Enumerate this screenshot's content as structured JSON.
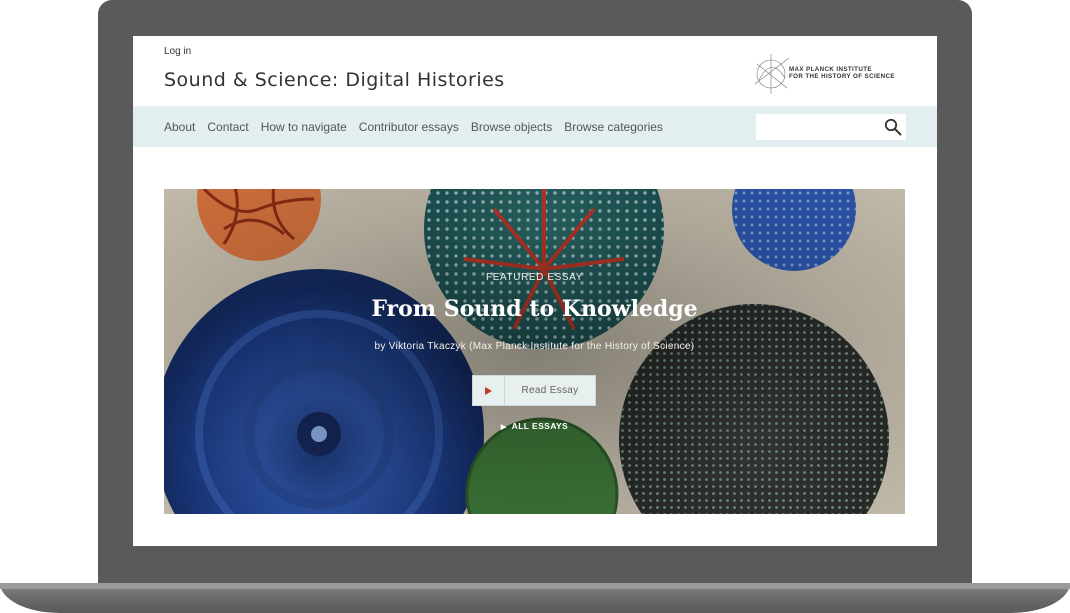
{
  "header": {
    "login": "Log in",
    "site_title": "Sound & Science: Digital Histories",
    "logo_line1": "MAX PLANCK INSTITUTE",
    "logo_line2": "FOR THE HISTORY OF SCIENCE"
  },
  "nav": {
    "items": [
      {
        "label": "About"
      },
      {
        "label": "Contact"
      },
      {
        "label": "How to navigate"
      },
      {
        "label": "Contributor essays"
      },
      {
        "label": "Browse objects"
      },
      {
        "label": "Browse categories"
      }
    ],
    "search_placeholder": "",
    "search_icon": "magnifier-icon"
  },
  "hero": {
    "kicker": "FEATURED ESSAY",
    "title": "From Sound to Knowledge",
    "byline": "by Viktoria Tkaczyk (Max Planck Institute for the History of Science)",
    "button_label": "Read Essay",
    "button_icon": "play-icon",
    "all_essays": "ALL ESSAYS",
    "play_color": "#c0392b"
  }
}
